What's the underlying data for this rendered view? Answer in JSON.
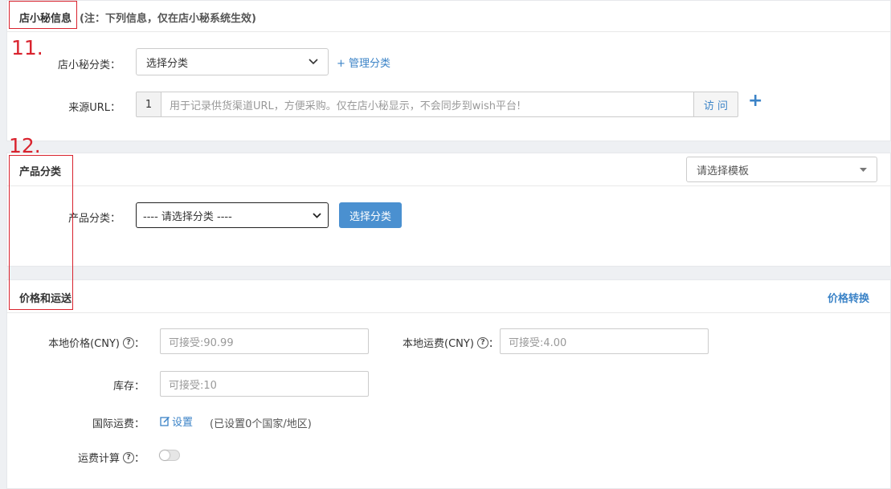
{
  "colors": {
    "accent": "#3b83c7",
    "annotation": "#d9232e",
    "primary_button": "#4a90d0"
  },
  "store_info": {
    "title": "店小秘信息",
    "note": "(注：下列信息，仅在店小秘系统生效)",
    "category_label": "店小秘分类：",
    "category_value": "选择分类",
    "manage_category_link": "+ 管理分类",
    "source_url_label": "来源URL：",
    "source_url_index": "1",
    "source_url_placeholder": "用于记录供货渠道URL，方便采购。仅在店小秘显示，不会同步到wish平台!",
    "visit_button": "访 问",
    "add_icon": "+"
  },
  "annotations": {
    "num_11": "11.",
    "num_12": "12."
  },
  "product_category": {
    "title": "产品分类",
    "template_select_value": "请选择模板",
    "category_label": "产品分类：",
    "category_select_value": "---- 请选择分类 ----",
    "choose_button": "选择分类"
  },
  "price_shipping": {
    "title": "价格和运送",
    "convert_link": "价格转换",
    "local_price_label": "本地价格(CNY)",
    "local_price_placeholder": "可接受:90.99",
    "local_shipping_label": "本地运费(CNY)",
    "local_shipping_placeholder": "可接受:4.00",
    "stock_label": "库存：",
    "stock_placeholder": "可接受:10",
    "intl_shipping_label": "国际运费：",
    "intl_shipping_link": "设置",
    "intl_shipping_status": "(已设置0个国家/地区)",
    "shipping_calc_label": "运费计算",
    "help_glyph": "?",
    "colon": "："
  }
}
